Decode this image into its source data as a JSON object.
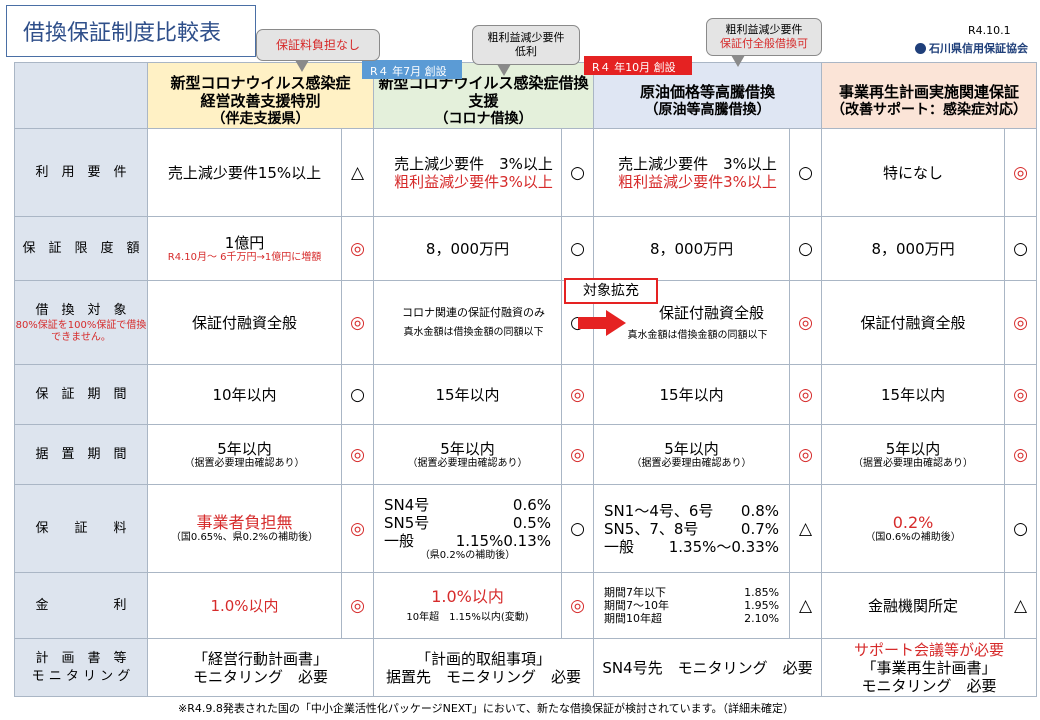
{
  "title": "借換保証制度比較表",
  "date": "R4.10.1",
  "org": "石川県信用保証協会",
  "callouts": {
    "a": "保証料負担なし",
    "b_line1": "粗利益減少要件",
    "b_line2": "低利",
    "c_line1": "粗利益減少要件",
    "c_line2": "保証付全般借換可"
  },
  "tags": {
    "blue": "R４ 年7月 創設",
    "red": "R４ 年10月 創設"
  },
  "headers": {
    "col1": [
      "新型コロナウイルス感染症",
      "経営改善支援特別",
      "（伴走支援県）"
    ],
    "col2": [
      "新型コロナウイルス感染症借換支援",
      "（コロナ借換）"
    ],
    "col3": [
      "原油価格等高騰借換",
      "（原油等高騰借換）"
    ],
    "col4": [
      "事業再生計画実施関連保証",
      "（改善サポート：感染症対応）"
    ]
  },
  "rows": {
    "riyo": {
      "label": "利　用　要　件",
      "c1": "売上減少要件15%以上",
      "m1": "△",
      "c2a": "売上減少要件　3%以上",
      "c2b": "粗利益減少要件3%以上",
      "m2": "○",
      "c3a": "売上減少要件　3%以上",
      "c3b": "粗利益減少要件3%以上",
      "m3": "○",
      "c4": "特になし",
      "m4": "◎"
    },
    "gendo": {
      "label": "保　証　限　度　額",
      "c1": "1億円",
      "c1b": "R4.10月～ 6千万円→1億円に増額",
      "m1": "◎",
      "c2": "8，000万円",
      "m2": "○",
      "c3": "8，000万円",
      "m3": "○",
      "c4": "8，000万円",
      "m4": "○"
    },
    "taisho": {
      "label": "借　換　対　象",
      "label_note": "80%保証を100%保証で借換できません。",
      "expand": "対象拡充",
      "c1": "保証付融資全般",
      "m1": "◎",
      "c2": "コロナ関連の保証付融資のみ",
      "c2b": "真水金額は借換金額の同額以下",
      "m2": "○",
      "c3": "保証付融資全般",
      "c3b": "真水金額は借換金額の同額以下",
      "m3": "◎",
      "c4": "保証付融資全般",
      "m4": "◎"
    },
    "kikan": {
      "label": "保　証　期　間",
      "c1": "10年以内",
      "m1": "○",
      "c2": "15年以内",
      "m2": "◎",
      "c3": "15年以内",
      "m3": "◎",
      "c4": "15年以内",
      "m4": "◎"
    },
    "sueoki": {
      "label": "据　置　期　間",
      "c1": "5年以内",
      "c1b": "（据置必要理由確認あり）",
      "m1": "◎",
      "c2": "5年以内",
      "c2b": "（据置必要理由確認あり）",
      "m2": "◎",
      "c3": "5年以内",
      "c3b": "（据置必要理由確認あり）",
      "m3": "◎",
      "c4": "5年以内",
      "c4b": "（据置必要理由確認あり）",
      "m4": "◎"
    },
    "hoshoryo": {
      "label": "保　　証　　料",
      "c1": "事業者負担無",
      "c1b": "（国0.65%、県0.2%の補助後）",
      "m1": "◎",
      "c2_l1a": "SN4号",
      "c2_l1b": "0.6%",
      "c2_l2a": "SN5号",
      "c2_l2b": "0.5%",
      "c2_l3a": "一般",
      "c2_l3b": "1.15%0.13%",
      "c2_note": "（県0.2%の補助後）",
      "m2": "○",
      "c3_l1a": "SN1～4号、6号",
      "c3_l1b": "0.8%",
      "c3_l2a": "SN5、7、8号",
      "c3_l2b": "0.7%",
      "c3_l3a": "一般",
      "c3_l3b": "1.35%～0.33%",
      "m3": "△",
      "c4": "0.2%",
      "c4b": "（国0.6%の補助後）",
      "m4": "○"
    },
    "kinri": {
      "label": "金　　　　　利",
      "c1": "1.0%以内",
      "m1": "◎",
      "c2": "1.0%以内",
      "c2b": "10年超　1.15%以内(変動)",
      "m2": "◎",
      "c3_l1a": "期間7年以下",
      "c3_l1b": "1.85%",
      "c3_l2a": "期間7～10年",
      "c3_l2b": "1.95%",
      "c3_l3a": "期間10年超",
      "c3_l3b": "2.10%",
      "m3": "△",
      "c4": "金融機関所定",
      "m4": "△"
    },
    "keikaku": {
      "label1": "計　画　書　等",
      "label2": "モ ニ タ リ ン グ",
      "c1a": "「経営行動計画書」",
      "c1b": "モニタリング　必要",
      "c2a": "「計画的取組事項」",
      "c2b": "据置先　モニタリング　必要",
      "c3": "SN4号先　モニタリング　必要",
      "c4a": "サポート会議等が必要",
      "c4b": "「事業再生計画書」",
      "c4c": "モニタリング　必要"
    }
  },
  "footnote": "※R4.9.8発表された国の「中小企業活性化パッケージNEXT」において、新たな借換保証が検討されています。（詳細未確定）",
  "colors": {
    "accent_red": "#d62b2b",
    "accent_blue": "#5b9bd5",
    "title_blue": "#2f4f8a"
  }
}
